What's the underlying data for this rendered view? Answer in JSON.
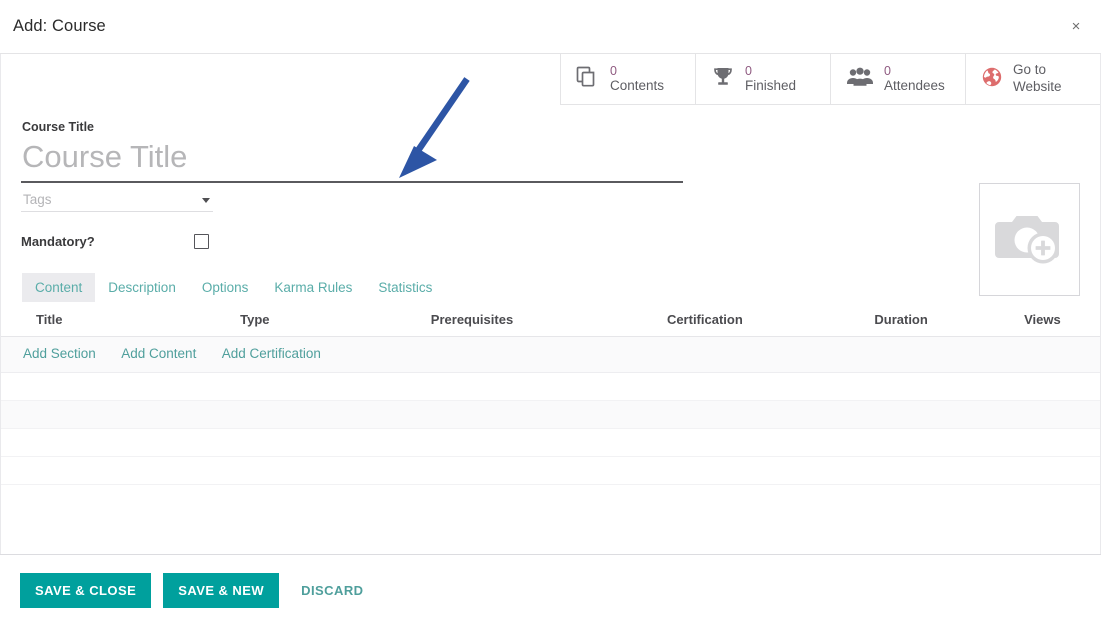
{
  "dialog": {
    "title": "Add: Course",
    "close_label": "×"
  },
  "stat_buttons": [
    {
      "value": "0",
      "label": "Contents",
      "icon": "copy-documents-icon"
    },
    {
      "value": "0",
      "label": "Finished",
      "icon": "trophy-icon"
    },
    {
      "value": "0",
      "label": "Attendees",
      "icon": "people-group-icon"
    },
    {
      "value": "",
      "label_line1": "Go to",
      "label_line2": "Website",
      "icon": "globe-icon"
    }
  ],
  "form": {
    "course_title_label": "Course Title",
    "course_title_value": "",
    "course_title_placeholder": "Course Title",
    "tags_value": "",
    "tags_placeholder": "Tags",
    "mandatory_label": "Mandatory?",
    "mandatory_checked": false,
    "image_placeholder_icon": "camera-add-icon"
  },
  "tabs": [
    {
      "label": "Content",
      "active": true
    },
    {
      "label": "Description",
      "active": false
    },
    {
      "label": "Options",
      "active": false
    },
    {
      "label": "Karma Rules",
      "active": false
    },
    {
      "label": "Statistics",
      "active": false
    }
  ],
  "table": {
    "columns": [
      "Title",
      "Type",
      "Prerequisites",
      "Certification",
      "Duration",
      "Views"
    ],
    "rows": [],
    "add_links": [
      "Add Section",
      "Add Content",
      "Add Certification"
    ]
  },
  "footer": {
    "save_close": "SAVE & CLOSE",
    "save_new": "SAVE & NEW",
    "discard": "DISCARD"
  },
  "colors": {
    "accent_teal": "#00a09d",
    "link_teal": "#4f9f9c",
    "brand_purple": "#875a7b",
    "globe_red": "#dd6d6d",
    "annotation_blue": "#2d55a5"
  }
}
